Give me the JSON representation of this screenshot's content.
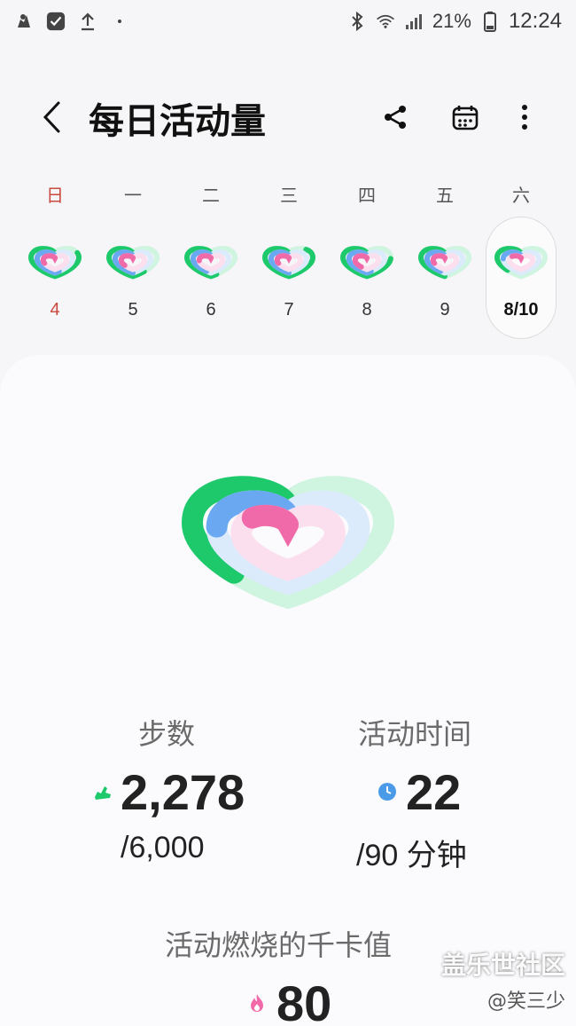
{
  "status_bar": {
    "battery_percent": "21%",
    "time": "12:24"
  },
  "header": {
    "title": "每日活动量"
  },
  "week": {
    "days": [
      {
        "dow": "日",
        "date": "4"
      },
      {
        "dow": "一",
        "date": "5"
      },
      {
        "dow": "二",
        "date": "6"
      },
      {
        "dow": "三",
        "date": "7"
      },
      {
        "dow": "四",
        "date": "8"
      },
      {
        "dow": "五",
        "date": "9"
      },
      {
        "dow": "六",
        "date": "8/10"
      }
    ],
    "selected_index": 6
  },
  "rings": {
    "steps_progress": 0.38,
    "active_time_progress": 0.24,
    "calories_progress": 0.16
  },
  "colors": {
    "steps": "#1ec96b",
    "active_time": "#6aa8f2",
    "calories": "#f06aa9",
    "sunday": "#c8493e"
  },
  "stats": {
    "steps": {
      "label": "步数",
      "value": "2,278",
      "goal": "/6,000",
      "icon": "shoe-icon"
    },
    "active_time": {
      "label": "活动时间",
      "value": "22",
      "goal": "/90 分钟",
      "icon": "clock-icon"
    },
    "calories": {
      "label": "活动燃烧的千卡值",
      "value": "80",
      "icon": "flame-icon"
    }
  },
  "watermark": {
    "site": "盖乐世社区",
    "user": "@笑三少"
  }
}
